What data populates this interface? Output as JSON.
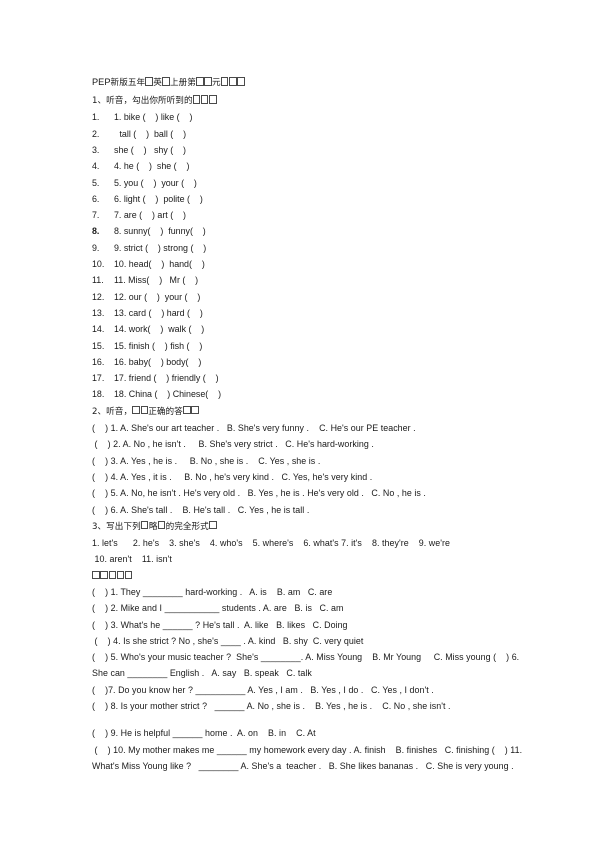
{
  "document": {
    "title_prefix": "PEP",
    "title_text": "PEP新版五年□英□上册第□□元□□□",
    "title_parts": [
      {
        "t": "PEP",
        "k": "ascii"
      },
      {
        "t": "新版五年",
        "k": "cjk"
      },
      {
        "t": "1",
        "k": "tofu"
      },
      {
        "t": "英",
        "k": "cjk"
      },
      {
        "t": "1",
        "k": "tofu"
      },
      {
        "t": "上册第",
        "k": "cjk"
      },
      {
        "t": "2",
        "k": "tofu"
      },
      {
        "t": "元",
        "k": "cjk"
      },
      {
        "t": "3",
        "k": "tofu"
      }
    ]
  },
  "section1": {
    "heading_parts": [
      {
        "t": "1、听音，勾出你所听到的",
        "k": "cjk"
      },
      {
        "t": "3",
        "k": "tofu"
      }
    ],
    "heading_plain": "1、听音，勾出你所听到的□□□",
    "items": [
      {
        "gutter": "1.",
        "text": "1. bike (    ) like (    )"
      },
      {
        "gutter": "2.",
        "text": " tall (    )  ball (    )",
        "indent": 1
      },
      {
        "gutter": "3.",
        "text": "she (    )   shy (    )"
      },
      {
        "gutter": "4.",
        "text": "4. he (    )  she (    )"
      },
      {
        "gutter": "5.",
        "text": "5. you (    )  your (    )"
      },
      {
        "gutter": "6.",
        "text": "6. light (    )  polite (    )"
      },
      {
        "gutter": "7.",
        "text": "7. are (    ) art (    )"
      },
      {
        "gutter": "8.",
        "text": "8. sunny(    )  funny(    )",
        "bold_gutter": true
      },
      {
        "gutter": "9.",
        "text": "9. strict (    ) strong (    )"
      },
      {
        "gutter": "10.",
        "text": "10. head(    )  hand(    )"
      },
      {
        "gutter": "11.",
        "text": "11. Miss(    )   Mr (    )"
      },
      {
        "gutter": "12.",
        "text": "12. our (    )  your (    )"
      },
      {
        "gutter": "13.",
        "text": "13. card (    ) hard (    )"
      },
      {
        "gutter": "14.",
        "text": "14. work(    )  walk (    )"
      },
      {
        "gutter": "15.",
        "text": "15. finish (    ) fish (    )"
      },
      {
        "gutter": "16.",
        "text": "16. baby(    ) body(    )"
      },
      {
        "gutter": "17.",
        "text": "17. friend (    ) friendly (    )"
      },
      {
        "gutter": "18.",
        "text": "18. China (    ) Chinese(    )"
      }
    ]
  },
  "section2": {
    "heading_parts": [
      {
        "t": "2、听音，",
        "k": "cjk"
      },
      {
        "t": "2",
        "k": "tofu"
      },
      {
        "t": "正确的答",
        "k": "cjk"
      },
      {
        "t": "2",
        "k": "tofu"
      }
    ],
    "heading_plain": "2、听音，□□正确的答□□",
    "items": [
      "(    ) 1. A. She's our art teacher .   B. She's very funny .    C. He's our PE teacher .",
      " (    ) 2. A. No , he isn't .     B. She's very strict .   C. He's hard-working .",
      "(    ) 3. A. Yes , he is .     B. No , she is .    C. Yes , she is .",
      "(    ) 4. A. Yes , it is .     B. No , he's very kind .   C. Yes, he's very kind .",
      "(    ) 5. A. No, he isn't . He's very old .   B. Yes , he is . He's very old .   C. No , he is .",
      "(    ) 6. A. She's tall .    B. He's tall .   C. Yes , he is tall ."
    ]
  },
  "section3": {
    "heading_parts": [
      {
        "t": "3、写出下列",
        "k": "cjk"
      },
      {
        "t": "1",
        "k": "tofu"
      },
      {
        "t": "略",
        "k": "cjk"
      },
      {
        "t": "1",
        "k": "tofu"
      },
      {
        "t": "的完全形式",
        "k": "cjk"
      },
      {
        "t": "1",
        "k": "tofu"
      }
    ],
    "heading_plain": "3、写出下列□略□的完全形式□",
    "line1": "1. let's      2. he's    3. she's    4. who's    5. where's    6. what's 7. it's    8. they're    9. we're",
    "line2": " 10. aren't    11. isn't"
  },
  "section4": {
    "heading_parts": [
      {
        "t": "5",
        "k": "tofu"
      }
    ],
    "heading_plain": "□、□□□□□",
    "items": [
      "(    ) 1. They ________ hard-working .   A. is    B. am   C. are",
      "(    ) 2. Mike and I ___________ students . A. are   B. is   C. am",
      "(    ) 3. What's he ______ ? He's tall .  A. like   B. likes   C. Doing",
      " (    ) 4. Is she strict ? No , she's ____ . A. kind   B. shy  C. very quiet",
      "(    ) 5. Who's your music teacher ?  She's ________. A. Miss Young    B. Mr Young     C. Miss young (    ) 6. She can ________ English .   A. say   B. speak   C. talk",
      "(    )7. Do you know her ? __________ A. Yes , I am .   B. Yes , I do .   C. Yes , I don't .",
      "(    ) 8. Is your mother strict ?   ______ A. No , she is .    B. Yes , he is .    C. No , she isn't .",
      "(    ) 9. He is helpful ______ home .  A. on    B. in    C. At",
      " (    ) 10. My mother makes me ______ my homework every day . A. finish    B. finishes   C. finishing (    ) 11. What's Miss Young like ?   ________ A. She's a  teacher .   B. She likes bananas .   C. She is very young ."
    ]
  }
}
